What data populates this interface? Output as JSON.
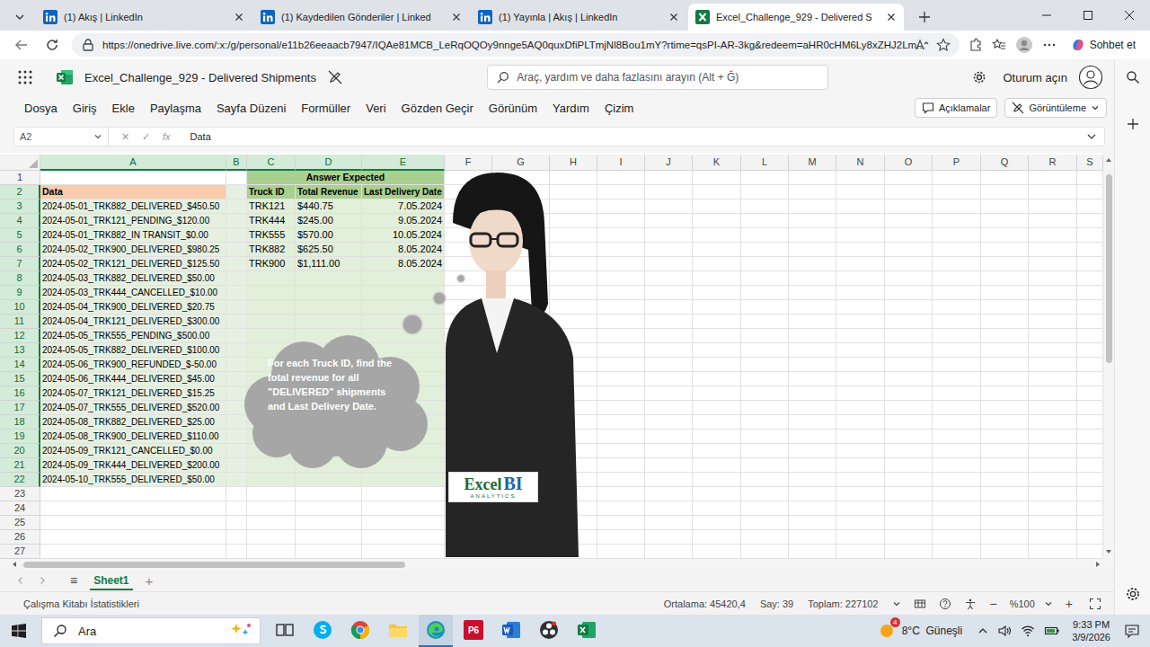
{
  "browser": {
    "tabs": [
      {
        "title": "(1) Akış | LinkedIn",
        "kind": "linkedin",
        "selected": false
      },
      {
        "title": "(1) Kaydedilen Gönderiler | Linked",
        "kind": "linkedin",
        "selected": false
      },
      {
        "title": "(1) Yayınla | Akış | LinkedIn",
        "kind": "linkedin",
        "selected": false
      },
      {
        "title": "Excel_Challenge_929 - Delivered S",
        "kind": "excel",
        "selected": true
      }
    ],
    "url": "https://onedrive.live.com/:x:/g/personal/e11b26eeaacb7947/IQAe81MCB_LeRqOQOy9nnge5AQ0quxDfiPLTmjNl8Bou1mY?rtime=qsPI-AR-3kg&redeem=aHR0cHM6Ly8xZHJ2Lm...",
    "copilot": "Sohbet et"
  },
  "app": {
    "title": "Excel_Challenge_929 - Delivered Shipments",
    "search_placeholder": "Araç, yardım ve daha fazlasını arayın (Alt + Ğ)",
    "sign_in": "Oturum açın"
  },
  "ribbon": {
    "menu": [
      {
        "label": "Dosya",
        "selected": false
      },
      {
        "label": "Giriş",
        "selected": false
      },
      {
        "label": "Ekle",
        "selected": false
      },
      {
        "label": "Paylaşma",
        "selected": false
      },
      {
        "label": "Sayfa Düzeni",
        "selected": false
      },
      {
        "label": "Formüller",
        "selected": false
      },
      {
        "label": "Veri",
        "selected": false
      },
      {
        "label": "Gözden Geçir",
        "selected": false
      },
      {
        "label": "Görünüm",
        "selected": false
      },
      {
        "label": "Yardım",
        "selected": false
      },
      {
        "label": "Çizim",
        "selected": false
      }
    ],
    "comments": "Açıklamalar",
    "view_mode": "Görüntüleme"
  },
  "formula_bar": {
    "name_box": "A2",
    "cancel": "✕",
    "enter": "✓",
    "fx": "fx",
    "value": "Data"
  },
  "sheet": {
    "columns": [
      {
        "label": "A",
        "selected": true
      },
      {
        "label": "B",
        "selected": true
      },
      {
        "label": "C",
        "selected": true
      },
      {
        "label": "D",
        "selected": true
      },
      {
        "label": "E",
        "selected": true
      },
      {
        "label": "F",
        "selected": false
      },
      {
        "label": "G",
        "selected": false
      },
      {
        "label": "H",
        "selected": false
      },
      {
        "label": "I",
        "selected": false
      },
      {
        "label": "J",
        "selected": false
      },
      {
        "label": "K",
        "selected": false
      },
      {
        "label": "L",
        "selected": false
      },
      {
        "label": "M",
        "selected": false
      },
      {
        "label": "N",
        "selected": false
      },
      {
        "label": "O",
        "selected": false
      },
      {
        "label": "P",
        "selected": false
      },
      {
        "label": "Q",
        "selected": false
      },
      {
        "label": "R",
        "selected": false
      },
      {
        "label": "S",
        "selected": false
      }
    ],
    "rows": [
      {
        "label": "1",
        "selected": false
      },
      {
        "label": "2",
        "selected": true
      },
      {
        "label": "3",
        "selected": true
      },
      {
        "label": "4",
        "selected": true
      },
      {
        "label": "5",
        "selected": true
      },
      {
        "label": "6",
        "selected": true
      },
      {
        "label": "7",
        "selected": true
      },
      {
        "label": "8",
        "selected": true
      },
      {
        "label": "9",
        "selected": true
      },
      {
        "label": "10",
        "selected": true
      },
      {
        "label": "11",
        "selected": true
      },
      {
        "label": "12",
        "selected": true
      },
      {
        "label": "13",
        "selected": true
      },
      {
        "label": "14",
        "selected": true
      },
      {
        "label": "15",
        "selected": true
      },
      {
        "label": "16",
        "selected": true
      },
      {
        "label": "17",
        "selected": true
      },
      {
        "label": "18",
        "selected": true
      },
      {
        "label": "19",
        "selected": true
      },
      {
        "label": "20",
        "selected": true
      },
      {
        "label": "21",
        "selected": true
      },
      {
        "label": "22",
        "selected": true
      },
      {
        "label": "23",
        "selected": false
      },
      {
        "label": "24",
        "selected": false
      },
      {
        "label": "25",
        "selected": false
      },
      {
        "label": "26",
        "selected": false
      },
      {
        "label": "27",
        "selected": false
      }
    ],
    "title": "Answer Expected",
    "header_a": "Data",
    "answer_headers": [
      "Truck ID",
      "Total Revenue",
      "Last Delivery Date"
    ],
    "records": [
      "2024-05-01_TRK882_DELIVERED_$450.50",
      "2024-05-01_TRK121_PENDING_$120.00",
      "2024-05-01_TRK882_IN TRANSIT_$0.00",
      "2024-05-02_TRK900_DELIVERED_$980.25",
      "2024-05-02_TRK121_DELIVERED_$125.50",
      "2024-05-03_TRK882_DELIVERED_$50.00",
      "2024-05-03_TRK444_CANCELLED_$10.00",
      "2024-05-04_TRK900_DELIVERED_$20.75",
      "2024-05-04_TRK121_DELIVERED_$300.00",
      "2024-05-05_TRK555_PENDING_$500.00",
      "2024-05-05_TRK882_DELIVERED_$100.00",
      "2024-05-06_TRK900_REFUNDED_$-50.00",
      "2024-05-06_TRK444_DELIVERED_$45.00",
      "2024-05-07_TRK121_DELIVERED_$15.25",
      "2024-05-07_TRK555_DELIVERED_$520.00",
      "2024-05-08_TRK882_DELIVERED_$25.00",
      "2024-05-08_TRK900_DELIVERED_$110.00",
      "2024-05-09_TRK121_CANCELLED_$0.00",
      "2024-05-09_TRK444_DELIVERED_$200.00",
      "2024-05-10_TRK555_DELIVERED_$50.00"
    ],
    "answers": [
      {
        "truck_id": "TRK121",
        "total_revenue": "$440.75",
        "last_delivery_date": "7.05.2024"
      },
      {
        "truck_id": "TRK444",
        "total_revenue": "$245.00",
        "last_delivery_date": "9.05.2024"
      },
      {
        "truck_id": "TRK555",
        "total_revenue": "$570.00",
        "last_delivery_date": "10.05.2024"
      },
      {
        "truck_id": "TRK882",
        "total_revenue": "$625.50",
        "last_delivery_date": "8.05.2024"
      },
      {
        "truck_id": "TRK900",
        "total_revenue": "$1,111.00",
        "last_delivery_date": "8.05.2024"
      }
    ]
  },
  "overlay": {
    "bubble_text": "For each Truck ID, find the total revenue for all \"DELIVERED\" shipments and Last Delivery Date.",
    "logo": {
      "word": "Excel",
      "accent": "BI",
      "tagline": "ANALYTICS"
    }
  },
  "sheet_tabs": {
    "menu": "≡",
    "tabs": [
      {
        "label": "Sheet1",
        "selected": true
      }
    ],
    "add": "+"
  },
  "status_bar": {
    "left": "Çalışma Kitabı İstatistikleri",
    "stats": [
      "Ortalama: 45420,4",
      "Say: 39",
      "Toplam: 227102"
    ],
    "zoom": "%100",
    "zoom_out": "−",
    "zoom_in": "+"
  },
  "taskbar": {
    "search": "Ara",
    "apps": [
      {
        "kind": "taskview",
        "glyph": "",
        "active": false
      },
      {
        "kind": "skype",
        "glyph": "",
        "active": false
      },
      {
        "kind": "chrome",
        "glyph": "",
        "active": false
      },
      {
        "kind": "explorer",
        "glyph": "",
        "active": false
      },
      {
        "kind": "edge",
        "glyph": "",
        "active": true
      },
      {
        "kind": "p6",
        "glyph": "P6",
        "active": false
      },
      {
        "kind": "word",
        "glyph": "",
        "active": false
      },
      {
        "kind": "obs",
        "glyph": "",
        "active": false
      },
      {
        "kind": "excel",
        "glyph": "",
        "active": false
      }
    ],
    "weather_badge": "4",
    "weather": "8°C  Güneşli",
    "time": "9:33 PM",
    "date": "3/9/2026"
  }
}
